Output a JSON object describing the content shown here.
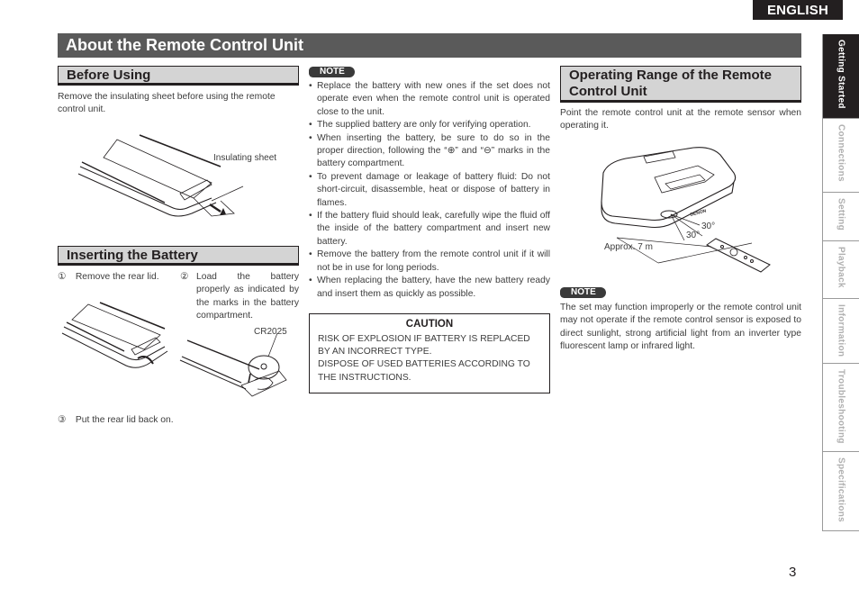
{
  "header": {
    "language": "ENGLISH",
    "title": "About the Remote Control Unit"
  },
  "sections": {
    "before_using": {
      "heading": "Before Using",
      "text": "Remove the insulating sheet before using the remote control unit.",
      "figure_label": "Insulating sheet"
    },
    "inserting_battery": {
      "heading": "Inserting the Battery",
      "steps": [
        {
          "num": "①",
          "text": "Remove the rear lid."
        },
        {
          "num": "②",
          "text": "Load the battery properly as indicated by the marks in the battery compartment."
        },
        {
          "num": "③",
          "text": "Put the rear lid back on."
        }
      ],
      "battery_label": "CR2025"
    },
    "note1": {
      "badge": "NOTE",
      "items": [
        "Replace the battery with new ones if the set does not operate even when the remote control unit is operated close to the unit.",
        "The supplied battery are only for verifying operation.",
        "When inserting the battery, be sure to do so in the proper direction, following the “⊕” and “⊖” marks in the battery compartment.",
        "To prevent damage or leakage of battery fluid: Do not short-circuit, disassemble, heat or dispose of battery in flames.",
        "If the battery fluid should leak, carefully wipe the fluid off the inside of the battery compartment and insert new battery.",
        "Remove the battery from the remote control unit if it will not be in use for long periods.",
        "When replacing the battery, have the new battery ready and insert them as quickly as possible."
      ]
    },
    "caution": {
      "title": "CAUTION",
      "lines": [
        "RISK OF EXPLOSION IF BATTERY IS REPLACED",
        "BY AN INCORRECT TYPE.",
        "DISPOSE OF USED BATTERIES ACCORDING TO",
        "THE INSTRUCTIONS."
      ]
    },
    "operating_range": {
      "heading": "Operating Range of the Remote Control Unit",
      "text": "Point the remote control unit at the remote sensor when operating it.",
      "distance_label": "Approx. 7 m",
      "angle_label_1": "30°",
      "angle_label_2": "30°",
      "brand_label": "DENON"
    },
    "note2": {
      "badge": "NOTE",
      "text": "The set may function improperly or the remote control unit may not operate if the remote control sensor is exposed to direct sunlight, strong artificial light from an inverter type fluorescent lamp or infrared light."
    }
  },
  "side_tabs": [
    {
      "label": "Getting Started",
      "active": true
    },
    {
      "label": "Connections",
      "active": false
    },
    {
      "label": "Setting",
      "active": false
    },
    {
      "label": "Playback",
      "active": false
    },
    {
      "label": "Information",
      "active": false
    },
    {
      "label": "Troubleshooting",
      "active": false
    },
    {
      "label": "Specifications",
      "active": false
    }
  ],
  "page_number": "3"
}
